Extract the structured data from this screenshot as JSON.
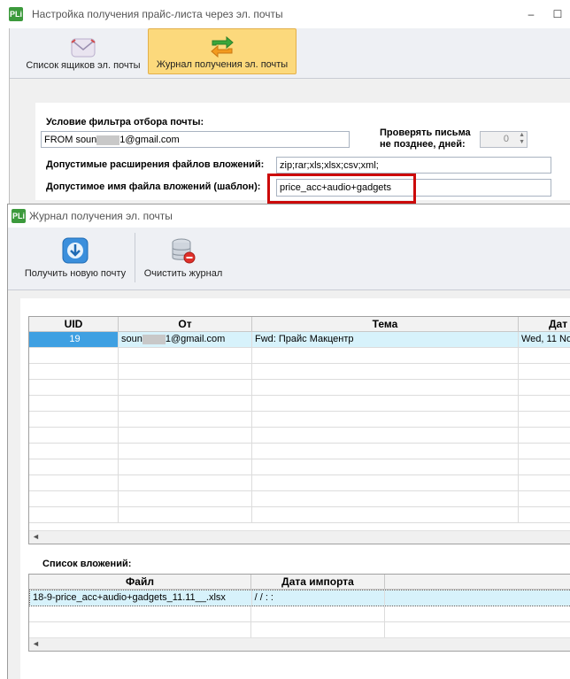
{
  "settings_window": {
    "app_icon": "PLi",
    "title": "Настройка получения прайс-листа через эл. почты",
    "controls": {
      "minimize": "–",
      "maximize": "☐",
      "close": "✕"
    },
    "ribbon": {
      "mailboxes_label": "Список ящиков эл. почты",
      "journal_label": "Журнал получения эл. почты"
    },
    "filter_label": "Условие фильтра отбора почты:",
    "filter_value_prefix": "FROM soun",
    "filter_value_suffix": "1@gmail.com",
    "check_days_label_line1": "Проверять письма",
    "check_days_label_line2": "не позднее, дней:",
    "check_days_value": "0",
    "extensions_label": "Допустимые расширения файлов вложений:",
    "extensions_value": "zip;rar;xls;xlsx;csv;xml;",
    "filename_label": "Допустимое имя файла вложений (шаблон):",
    "filename_value": "price_acc+audio+gadgets"
  },
  "journal_window": {
    "app_icon": "PLi",
    "title": "Журнал получения эл. почты",
    "toolbar": {
      "get_mail_label": "Получить новую почту",
      "clear_label": "Очистить журнал"
    },
    "mail_grid": {
      "columns": [
        "UID",
        "От",
        "Тема",
        "Дат"
      ],
      "rows": [
        {
          "uid": "19",
          "from_prefix": "soun",
          "from_suffix": "1@gmail.com",
          "subject": "Fwd: Прайс Макцентр",
          "date": "Wed, 11 No"
        }
      ]
    },
    "attachments_label": "Список вложений:",
    "attachments_grid": {
      "columns": [
        "Файл",
        "Дата импорта"
      ],
      "rows": [
        {
          "file": "18-9-price_acc+audio+gadgets_11.11__.xlsx",
          "import_date": " /  /      :  :"
        }
      ]
    }
  },
  "colors": {
    "selected_cell": "#3ea0e2",
    "selected_row": "#d7f2fb",
    "highlight_box": "#cc0a0a",
    "active_ribbon": "#fcd97c"
  }
}
